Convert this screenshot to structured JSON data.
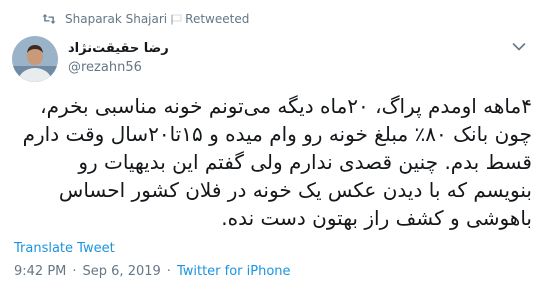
{
  "retweet": {
    "retweeter": "Shaparak Shajari",
    "label": "Retweeted"
  },
  "author": {
    "name": "رضا حقیقت‌نژاد",
    "handle": "@rezahn56"
  },
  "tweet": {
    "text": "۴ماهه اومدم پراگ، ۲۰ماه دیگه می‌تونم خونه مناسبی بخرم،\nچون بانک ۸۰٪ مبلغ خونه رو وام میده و ۱۵تا۲۰سال وقت دارم\nقسط بدم. چنین قصدی ندارم ولی گفتم این بدیهیات رو\nبنویسم که با دیدن عکس یک خونه در فلان کشور احساس\nباهوشی و کشف راز بهتون دست نده."
  },
  "translate_label": "Translate Tweet",
  "meta": {
    "time": "9:42 PM",
    "separator": "·",
    "date": "Sep 6, 2019",
    "source": "Twitter for iPhone"
  },
  "icons": {
    "retweet": "retweet-icon",
    "flag": "flag-icon",
    "caret": "chevron-down-icon",
    "avatar": "avatar"
  },
  "colors": {
    "text": "#14171a",
    "secondary": "#657786",
    "link": "#1b95e0"
  }
}
